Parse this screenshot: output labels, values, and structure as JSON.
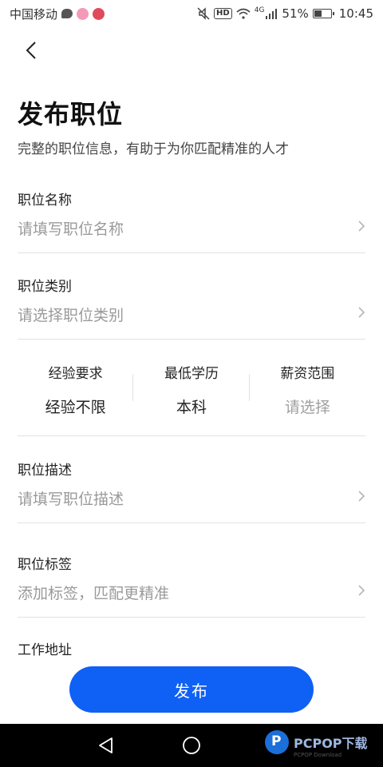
{
  "status_bar": {
    "carrier": "中国移动",
    "network": "4G",
    "battery_text": "51%",
    "battery_level": 0.51,
    "time": "10:45",
    "icons": [
      "message-icon",
      "app-notification-icon",
      "heart-notification-icon",
      "mute-icon",
      "hd-icon",
      "wifi-icon",
      "signal-icon",
      "battery-icon"
    ]
  },
  "header": {
    "title": "发布职位",
    "subtitle": "完整的职位信息，有助于为你匹配精准的人才"
  },
  "fields": {
    "job_name": {
      "label": "职位名称",
      "placeholder": "请填写职位名称"
    },
    "job_category": {
      "label": "职位类别",
      "placeholder": "请选择职位类别"
    },
    "job_description": {
      "label": "职位描述",
      "placeholder": "请填写职位描述"
    },
    "job_tags": {
      "label": "职位标签",
      "placeholder": "添加标签，匹配更精准"
    },
    "work_address": {
      "label": "工作地址"
    }
  },
  "requirements": {
    "experience": {
      "label": "经验要求",
      "value": "经验不限"
    },
    "education": {
      "label": "最低学历",
      "value": "本科"
    },
    "salary": {
      "label": "薪资范围",
      "value": "请选择"
    }
  },
  "actions": {
    "publish_label": "发布"
  },
  "watermark": {
    "text": "PCPOP下载",
    "sub": "PCPOP Download"
  },
  "colors": {
    "primary": "#0f61f5",
    "placeholder": "#9a9a9a",
    "divider": "#e2e2e2"
  }
}
